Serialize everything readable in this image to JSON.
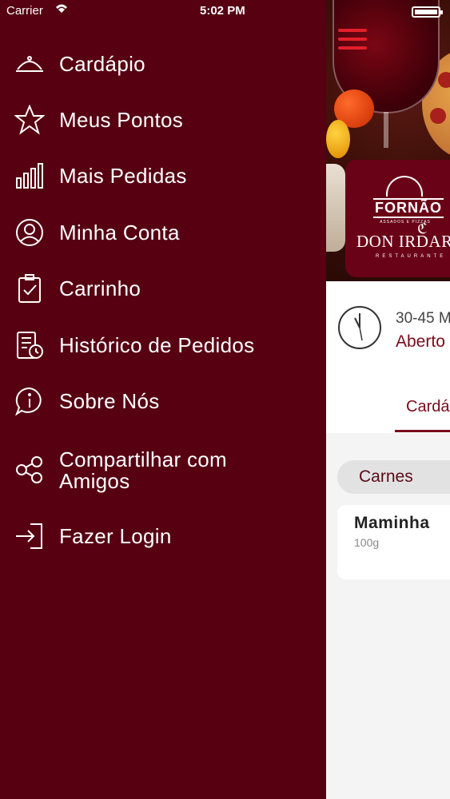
{
  "status_bar": {
    "carrier": "Carrier",
    "time": "5:02 PM",
    "wifi_icon": "wifi-icon",
    "battery_icon": "battery-icon"
  },
  "menu": {
    "items": [
      {
        "label": "Cardápio",
        "icon": "cloche-icon"
      },
      {
        "label": "Meus Pontos",
        "icon": "star-icon"
      },
      {
        "label": "Mais Pedidas",
        "icon": "bar-chart-icon"
      },
      {
        "label": "Minha Conta",
        "icon": "user-circle-icon"
      },
      {
        "label": "Carrinho",
        "icon": "clipboard-check-icon"
      },
      {
        "label": "Histórico de Pedidos",
        "icon": "receipt-clock-icon"
      },
      {
        "label": "Sobre Nós",
        "icon": "info-bubble-icon"
      },
      {
        "label": "Compartilhar com Amigos",
        "icon": "share-icon"
      },
      {
        "label": "Fazer Login",
        "icon": "login-icon"
      }
    ]
  },
  "restaurant": {
    "logo_fornao": "FORNÃO",
    "logo_fornao_sub": "ASSADOS E PIZZAS",
    "logo_don": "DON IRDARA",
    "logo_don_sub": "RESTAURANTE",
    "eta": "30-45 M",
    "open_status": "Aberto"
  },
  "tabs": {
    "active": "Cardá"
  },
  "category": {
    "name": "Carnes"
  },
  "product": {
    "name": "Maminha",
    "description": "100g"
  },
  "colors": {
    "drawer_bg": "#560012",
    "accent": "#7a0a1c",
    "hamburger": "#e21f2a"
  }
}
